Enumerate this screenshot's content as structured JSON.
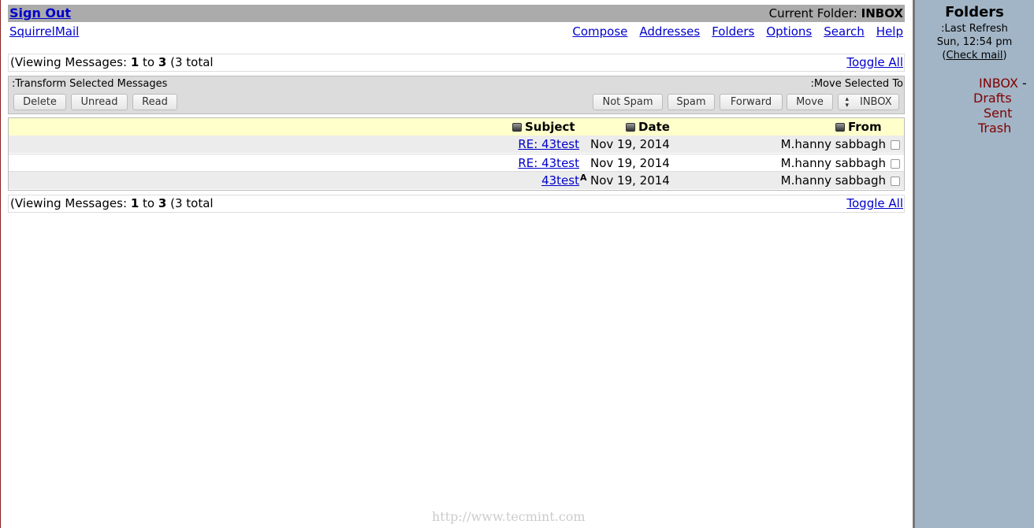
{
  "topbar": {
    "sign_out": "Sign Out",
    "current_folder_label": "Current Folder:",
    "current_folder": "INBOX"
  },
  "brand": "SquirrelMail",
  "nav": [
    "Compose",
    "Addresses",
    "Folders",
    "Options",
    "Search",
    "Help"
  ],
  "pager": {
    "prefix": "(Viewing Messages:",
    "from": "1",
    "to_word": "to",
    "to": "3",
    "total": "(3 total",
    "toggle_all": "Toggle All"
  },
  "actions": {
    "transform_label": ":Transform Selected Messages",
    "move_label": ":Move Selected To",
    "delete": "Delete",
    "unread": "Unread",
    "read": "Read",
    "not_spam": "Not Spam",
    "spam": "Spam",
    "forward": "Forward",
    "move": "Move",
    "folder_select": "INBOX"
  },
  "columns": {
    "subject": "Subject",
    "date": "Date",
    "from": "From"
  },
  "messages": [
    {
      "subject": "RE: 43test",
      "flag": "",
      "date": "Nov 19, 2014",
      "from": "M.hanny sabbagh"
    },
    {
      "subject": "RE: 43test",
      "flag": "",
      "date": "Nov 19, 2014",
      "from": "M.hanny sabbagh"
    },
    {
      "subject": "43test",
      "flag": "A",
      "date": "Nov 19, 2014",
      "from": "M.hanny sabbagh"
    }
  ],
  "sidebar": {
    "title": "Folders",
    "last_refresh": ":Last Refresh",
    "time": "Sun, 12:54 pm",
    "check_open": "(",
    "check_mail": "Check mail",
    "check_close": ")",
    "folders": [
      "INBOX",
      "Drafts",
      "Sent",
      "Trash"
    ],
    "inbox_suffix": "-"
  },
  "watermark": "http://www.tecmint.com"
}
